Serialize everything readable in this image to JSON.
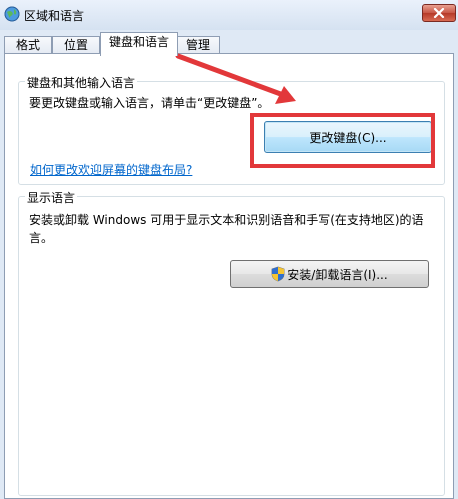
{
  "window": {
    "title": "区域和语言",
    "close_icon": "close-icon",
    "title_icon": "globe-icon"
  },
  "tabs": [
    {
      "label": "格式",
      "active": false
    },
    {
      "label": "位置",
      "active": false
    },
    {
      "label": "键盘和语言",
      "active": true
    },
    {
      "label": "管理",
      "active": false
    }
  ],
  "keyboard_group": {
    "legend": "键盘和其他输入语言",
    "description": "要更改键盘或输入语言，请单击“更改键盘”。",
    "change_button": "更改键盘(C)...",
    "help_link": "如何更改欢迎屏幕的键盘布局?"
  },
  "display_group": {
    "legend": "显示语言",
    "description": "安装或卸载 Windows 可用于显示文本和识别语音和手写(在支持地区)的语言。",
    "install_button": "安装/卸载语言(I)...",
    "install_icon": "uac-shield-icon"
  },
  "colors": {
    "annotation_red": "#e2383a",
    "link_blue": "#0066cc",
    "title_bar": "#dfe9f5"
  }
}
